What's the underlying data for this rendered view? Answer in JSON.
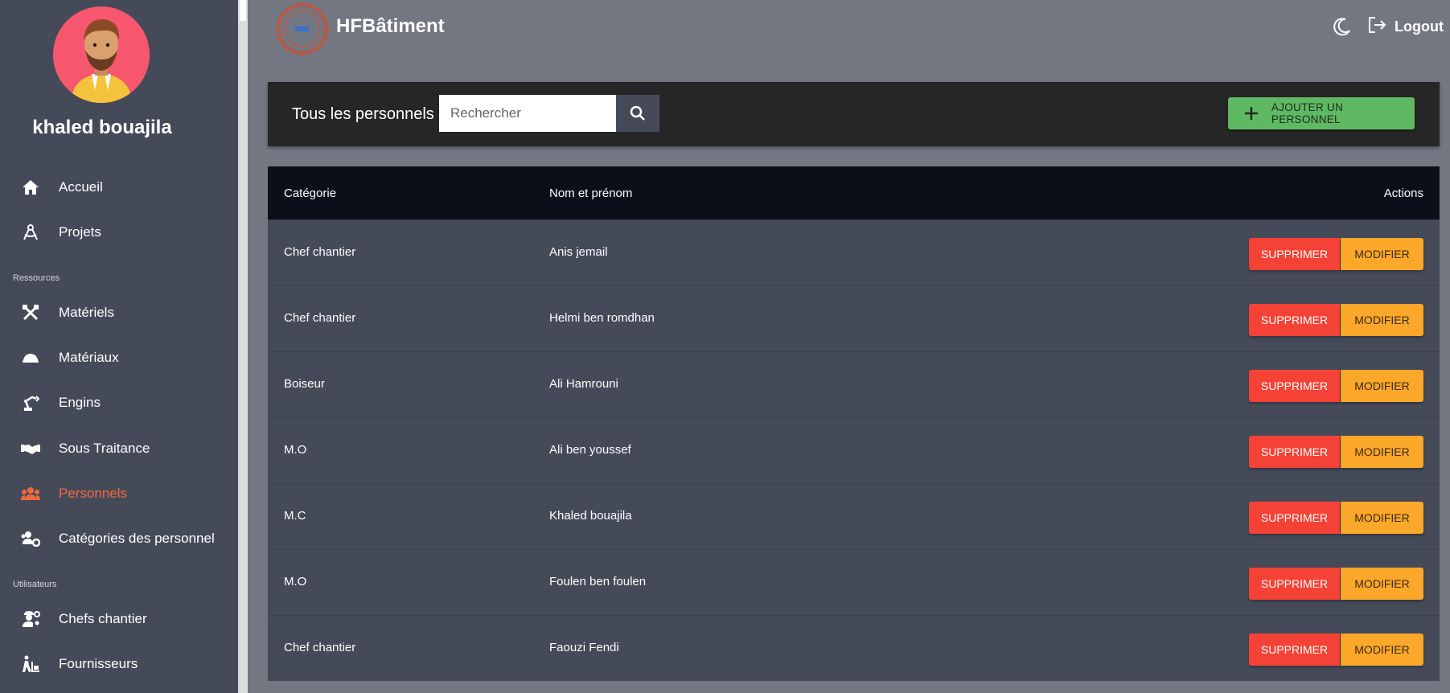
{
  "app": {
    "title": "HFBâtiment"
  },
  "user": {
    "name": "khaled bouajila"
  },
  "sidebar": {
    "items": [
      {
        "label": "Accueil",
        "icon": "home-icon"
      },
      {
        "label": "Projets",
        "icon": "compass-icon"
      },
      {
        "label": "Matériels",
        "icon": "tools-icon"
      },
      {
        "label": "Matériaux",
        "icon": "mound-icon"
      },
      {
        "label": "Engins",
        "icon": "robot-arm-icon"
      },
      {
        "label": "Sous Traitance",
        "icon": "handshake-icon"
      },
      {
        "label": "Personnels",
        "icon": "users-icon",
        "active": true
      },
      {
        "label": "Catégories des personnel",
        "icon": "users-gear-icon"
      },
      {
        "label": "Chefs chantier",
        "icon": "worker-gear-icon"
      },
      {
        "label": "Fournisseurs",
        "icon": "person-dolly-icon"
      }
    ],
    "sections": {
      "ressources": "Ressources",
      "utilisateurs": "Utilisateurs"
    }
  },
  "topbar": {
    "logout_label": "Logout"
  },
  "toolbar": {
    "title": "Tous les personnels",
    "search_placeholder": "Rechercher",
    "add_label": "AJOUTER UN PERSONNEL"
  },
  "table": {
    "headers": {
      "category": "Catégorie",
      "name": "Nom et prénom",
      "actions": "Actions"
    },
    "rows": [
      {
        "category": "Chef chantier",
        "name": "Anis jemail"
      },
      {
        "category": "Chef chantier",
        "name": "Helmi ben romdhan"
      },
      {
        "category": "Boiseur",
        "name": "Ali Hamrouni"
      },
      {
        "category": "M.O",
        "name": "Ali ben youssef"
      },
      {
        "category": "M.C",
        "name": "Khaled bouajila"
      },
      {
        "category": "M.O",
        "name": "Foulen ben foulen"
      },
      {
        "category": "Chef chantier",
        "name": "Faouzi Fendi"
      }
    ],
    "delete_label": "SUPPRIMER",
    "edit_label": "MODIFIER"
  },
  "colors": {
    "sidebar_bg": "#454a59",
    "page_bg": "#737782",
    "active": "#f26a3d",
    "add_button": "#5fb963",
    "delete_button": "#f44336",
    "edit_button": "#fba72a",
    "table_header": "#0b0f19"
  }
}
